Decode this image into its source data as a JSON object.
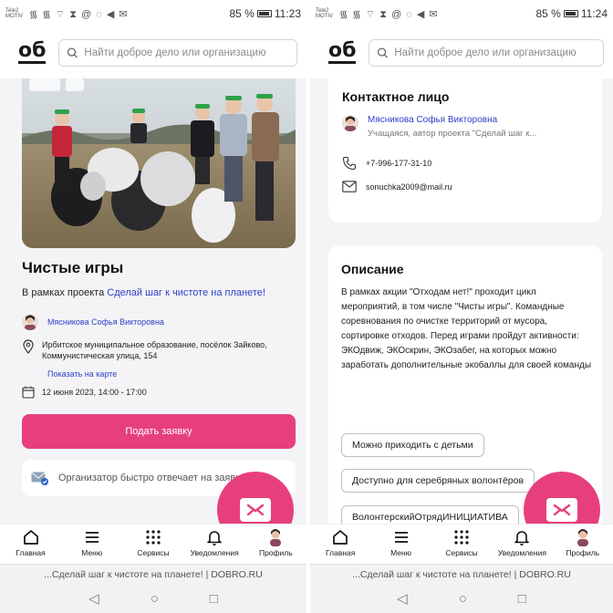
{
  "status_left": {
    "carrier": "Tele2 MOTIV",
    "icons": "᯾ ᯾ ⌔ ⧗ @ ◌ ◀ ✉",
    "battery_text": "85 %",
    "time": "11:23"
  },
  "status_right": {
    "carrier": "Tele2 MOTIV",
    "icons": "᯾ ᯾ ⌔ ⧗ @ ◌ ◀ ✉",
    "battery_text": "85 %",
    "time": "11:24"
  },
  "header": {
    "logo": "об",
    "search_placeholder": "Найти доброе дело или организацию"
  },
  "event": {
    "title": "Чистые игры",
    "project_prefix": "В рамках проекта ",
    "project_link": "Сделай шаг к чистоте на планете!",
    "organizer": "Мясникова Софья Викторовна",
    "address": "Ирбитское муниципальное образование, посёлок Зайково, Коммунистическая улица, 154",
    "map_link": "Показать на карте",
    "datetime": "12 июня 2023, 14:00 - 17:00",
    "apply_button": "Подать заявку",
    "organizer_note": "Организатор быстро отвечает на заявки"
  },
  "contact": {
    "title": "Контактное лицо",
    "name": "Мясникова Софья Викторовна",
    "role": "Учащаяся, автор проекта \"Сделай шаг к...",
    "phone": "+7-996-177-31-10",
    "email": "sonuchka2009@mail.ru"
  },
  "description": {
    "title": "Описание",
    "text": "В рамках акции \"Отходам нет!\" проходит цикл мероприятий, в том числе \"Чисты игры\". Командные соревнования по очистке территорий от мусора, сортировке отходов. Перед играми пройдут активности: ЭКОдвиж, ЭКОскрин, ЭКОзабег, на которых можно заработать дополнительные экобаллы для своей команды",
    "tags": [
      "Можно приходить с детьми",
      "Доступно для серебряных волонтёров",
      "ВолонтерскийОтрядИНИЦИАТИВА"
    ]
  },
  "bottom_nav": [
    {
      "label": "Главная",
      "icon": "home-icon"
    },
    {
      "label": "Меню",
      "icon": "menu-icon"
    },
    {
      "label": "Сервисы",
      "icon": "grid-icon"
    },
    {
      "label": "Уведомления",
      "icon": "bell-icon"
    },
    {
      "label": "Профиль",
      "icon": "profile-avatar"
    }
  ],
  "browser": {
    "url_text": "...Сделай шаг к чистоте на планете! | DOBRO.RU"
  },
  "colors": {
    "accent": "#e73f7e",
    "link": "#2d3fc7",
    "background": "#f4f4f6"
  }
}
